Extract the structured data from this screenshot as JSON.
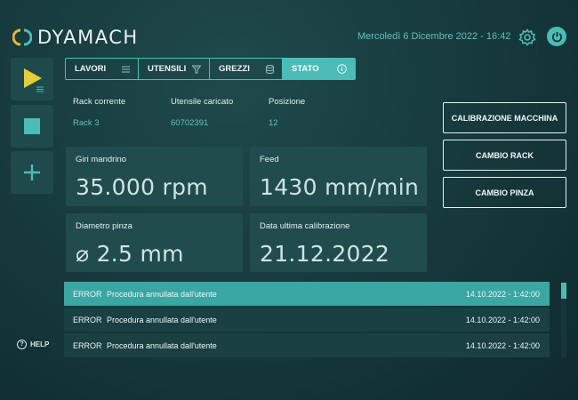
{
  "app": {
    "name": "DYAMACH"
  },
  "header": {
    "datetime": "Mercoledì 6 Dicembre 2022 - 16:42"
  },
  "icons": {
    "settings": "gear-icon",
    "power": "power-icon",
    "play": "play-icon",
    "stop": "stop-icon",
    "add": "plus-icon",
    "help": "help-icon"
  },
  "sidebar": {
    "help_label": "HELP"
  },
  "tabs": [
    {
      "label": "LAVORI",
      "icon": "list-icon"
    },
    {
      "label": "UTENSILI",
      "icon": "funnel-icon"
    },
    {
      "label": "GREZZI",
      "icon": "database-icon"
    },
    {
      "label": "STATO",
      "icon": "info-icon",
      "active": true
    }
  ],
  "info": {
    "rack_label": "Rack corrente",
    "rack_value": "Rack 3",
    "tool_label": "Utensile caricato",
    "tool_value": "60702391",
    "pos_label": "Posizione",
    "pos_value": "12"
  },
  "stats": {
    "spindle_label": "Giri mandrino",
    "spindle_value": "35.000 rpm",
    "feed_label": "Feed",
    "feed_value": "1430 mm/min",
    "collet_label": "Diametro pinza",
    "collet_value": "⌀ 2.5 mm",
    "calib_label": "Data ultima calibrazione",
    "calib_value": "21.12.2022"
  },
  "actions": {
    "calibrate": "CALIBRAZIONE MACCHINA",
    "rack_change": "CAMBIO RACK",
    "collet_change": "CAMBIO PINZA"
  },
  "log": [
    {
      "code": "ERROR",
      "message": "Procedura annullata dall'utente",
      "time": "14.10.2022 - 1:42:00"
    },
    {
      "code": "ERROR",
      "message": "Procedura annullata dall'utente",
      "time": "14.10.2022 - 1:42:00"
    },
    {
      "code": "ERROR",
      "message": "Procedura annullata dall'utente",
      "time": "14.10.2022 - 1:42:00"
    }
  ],
  "colors": {
    "accent": "#4cbcb6",
    "play": "#e4cf3a",
    "background": "#173b3e"
  }
}
